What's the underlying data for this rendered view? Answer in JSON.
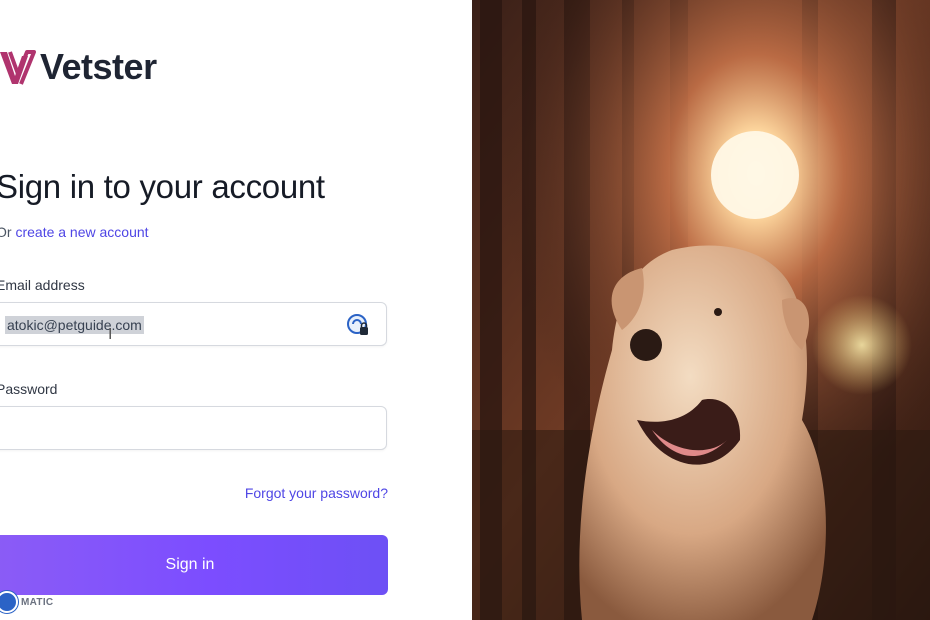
{
  "brand": {
    "name": "Vetster",
    "icon": "vetster-logo-icon",
    "accent": "#b0346e"
  },
  "signin": {
    "title": "Sign in to your account",
    "prefix": "Or",
    "create_link": "create a new account",
    "email_label": "Email address",
    "email_value": "atokic@petguide.com",
    "password_label": "Password",
    "password_value": "",
    "forgot_link": "Forgot your password?",
    "button_label": "Sign in",
    "button_color": "#7c4dff",
    "link_color": "#4f46e5"
  },
  "password_manager": {
    "icon": "password-manager-lock-icon"
  },
  "overlay_badge": {
    "text": "MATIC"
  },
  "hero": {
    "description_icon": "golden-retriever-photo"
  }
}
